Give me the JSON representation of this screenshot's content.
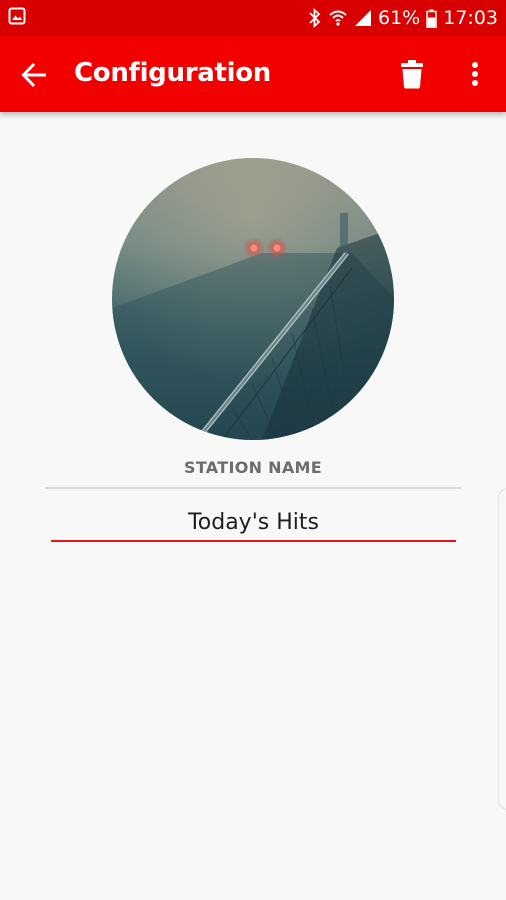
{
  "status_bar": {
    "bluetooth_icon": "bluetooth-icon",
    "wifi_icon": "wifi-icon",
    "signal_icon": "signal-icon",
    "battery_percent": "61%",
    "time": "17:03"
  },
  "app_bar": {
    "title": "Configuration",
    "back_icon": "arrow-left-icon",
    "delete_icon": "trash-icon",
    "more_icon": "more-vert-icon"
  },
  "station": {
    "section_label": "STATION NAME",
    "name_value": "Today's Hits"
  },
  "colors": {
    "status_bar": "#d80000",
    "app_bar": "#f20000",
    "accent": "#e8141a",
    "background": "#f8f8f8"
  }
}
